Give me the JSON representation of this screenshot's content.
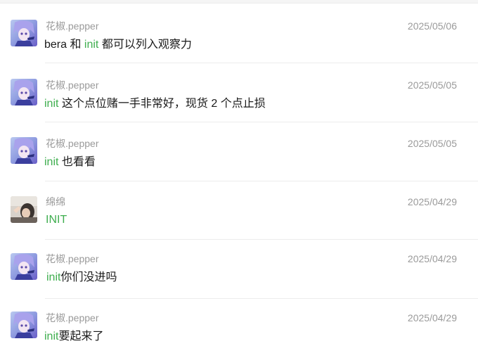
{
  "messages": [
    {
      "sender": "花椒.pepper",
      "date": "2025/05/06",
      "avatar": "anime-avatar",
      "parts": [
        {
          "text": "bera 和 ",
          "hl": false
        },
        {
          "text": "init",
          "hl": true
        },
        {
          "text": " 都可以列入观察力",
          "hl": false
        }
      ]
    },
    {
      "sender": "花椒.pepper",
      "date": "2025/05/05",
      "avatar": "anime-avatar",
      "parts": [
        {
          "text": "init",
          "hl": true
        },
        {
          "text": " 这个点位赌一手非常好，现货 2 个点止损",
          "hl": false
        }
      ]
    },
    {
      "sender": "花椒.pepper",
      "date": "2025/05/05",
      "avatar": "anime-avatar",
      "parts": [
        {
          "text": "init",
          "hl": true
        },
        {
          "text": " 也看看",
          "hl": false
        }
      ]
    },
    {
      "sender": "绵绵",
      "date": "2025/04/29",
      "avatar": "photo-avatar",
      "parts": [
        {
          "text": "INIT",
          "hl": true
        }
      ]
    },
    {
      "sender": "花椒.pepper",
      "date": "2025/04/29",
      "avatar": "anime-avatar",
      "parts": [
        {
          "text": "init",
          "hl": true
        },
        {
          "text": "你们没进吗",
          "hl": false
        }
      ]
    },
    {
      "sender": "花椒.pepper",
      "date": "2025/04/29",
      "avatar": "anime-avatar",
      "parts": [
        {
          "text": "init",
          "hl": true
        },
        {
          "text": "要起来了",
          "hl": false
        }
      ]
    }
  ],
  "colors": {
    "highlight": "#3fae4f",
    "meta": "#9a9a9a",
    "text": "#1a1a1a"
  }
}
